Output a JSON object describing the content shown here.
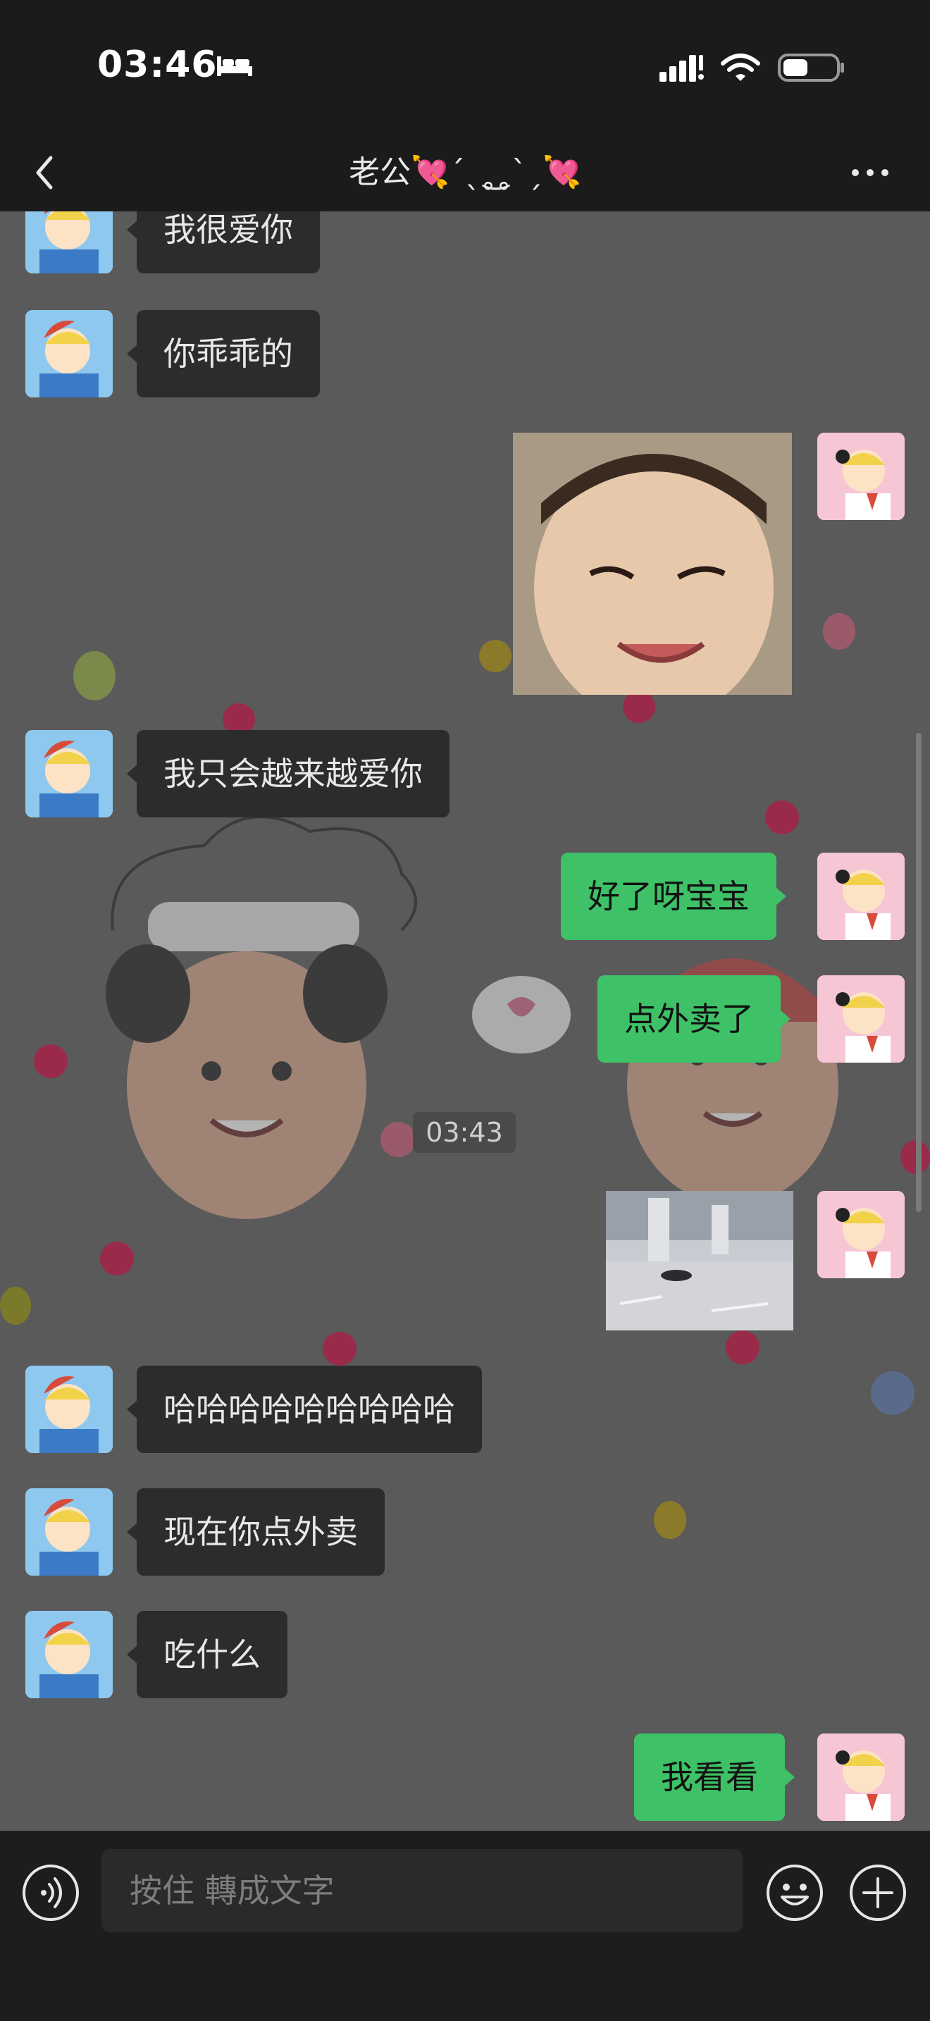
{
  "status_bar": {
    "time": "03:46"
  },
  "header": {
    "title": "老公💘ˊˎ˳͜˳ˋˏ💘"
  },
  "messages": [
    {
      "side": "left",
      "type": "text",
      "text": "我很爱你"
    },
    {
      "side": "left",
      "type": "text",
      "text": "你乖乖的"
    },
    {
      "side": "right",
      "type": "image",
      "content": "smiling child face sticker"
    },
    {
      "side": "left",
      "type": "text",
      "text": "我只会越来越爱你"
    },
    {
      "side": "right",
      "type": "text",
      "text": "好了呀宝宝"
    },
    {
      "side": "right",
      "type": "text",
      "text": "点外卖了"
    },
    {
      "side": "center",
      "type": "timestamp",
      "text": "03:43"
    },
    {
      "side": "right",
      "type": "image",
      "content": "subway station photo"
    },
    {
      "side": "left",
      "type": "text",
      "text": "哈哈哈哈哈哈哈哈哈"
    },
    {
      "side": "left",
      "type": "text",
      "text": "现在你点外卖"
    },
    {
      "side": "left",
      "type": "text",
      "text": "吃什么"
    },
    {
      "side": "right",
      "type": "text",
      "text": "我看看"
    }
  ],
  "input_bar": {
    "placeholder": "按住 轉成文字"
  },
  "icons": {
    "back": "chevron-left-icon",
    "more": "more-icon",
    "voice": "voice-icon",
    "emoji": "emoji-icon",
    "plus": "plus-icon"
  },
  "colors": {
    "outgoing_bubble": "#3ec167",
    "incoming_bubble": "#2c2c2c",
    "chat_background": "#5a5a5a"
  }
}
